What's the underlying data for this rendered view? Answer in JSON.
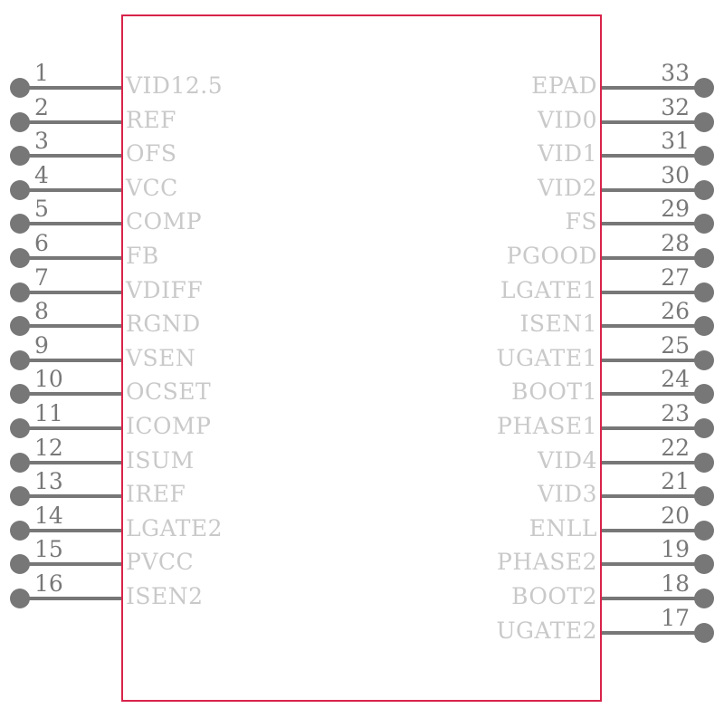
{
  "component": {
    "outline_color": "#d8234a",
    "wire_color": "#777777",
    "label_color": "#c9c9c9",
    "number_color": "#787878"
  },
  "pins_left": [
    {
      "number": "1",
      "label": "VID12.5"
    },
    {
      "number": "2",
      "label": "REF"
    },
    {
      "number": "3",
      "label": "OFS"
    },
    {
      "number": "4",
      "label": "VCC"
    },
    {
      "number": "5",
      "label": "COMP"
    },
    {
      "number": "6",
      "label": "FB"
    },
    {
      "number": "7",
      "label": "VDIFF"
    },
    {
      "number": "8",
      "label": "RGND"
    },
    {
      "number": "9",
      "label": "VSEN"
    },
    {
      "number": "10",
      "label": "OCSET"
    },
    {
      "number": "11",
      "label": "ICOMP"
    },
    {
      "number": "12",
      "label": "ISUM"
    },
    {
      "number": "13",
      "label": "IREF"
    },
    {
      "number": "14",
      "label": "LGATE2"
    },
    {
      "number": "15",
      "label": "PVCC"
    },
    {
      "number": "16",
      "label": "ISEN2"
    }
  ],
  "pins_right": [
    {
      "number": "33",
      "label": "EPAD"
    },
    {
      "number": "32",
      "label": "VID0"
    },
    {
      "number": "31",
      "label": "VID1"
    },
    {
      "number": "30",
      "label": "VID2"
    },
    {
      "number": "29",
      "label": "FS"
    },
    {
      "number": "28",
      "label": "PGOOD"
    },
    {
      "number": "27",
      "label": "LGATE1"
    },
    {
      "number": "26",
      "label": "ISEN1"
    },
    {
      "number": "25",
      "label": "UGATE1"
    },
    {
      "number": "24",
      "label": "BOOT1"
    },
    {
      "number": "23",
      "label": "PHASE1"
    },
    {
      "number": "22",
      "label": "VID4"
    },
    {
      "number": "21",
      "label": "VID3"
    },
    {
      "number": "20",
      "label": "ENLL"
    },
    {
      "number": "19",
      "label": "PHASE2"
    },
    {
      "number": "18",
      "label": "BOOT2"
    },
    {
      "number": "17",
      "label": "UGATE2"
    }
  ]
}
